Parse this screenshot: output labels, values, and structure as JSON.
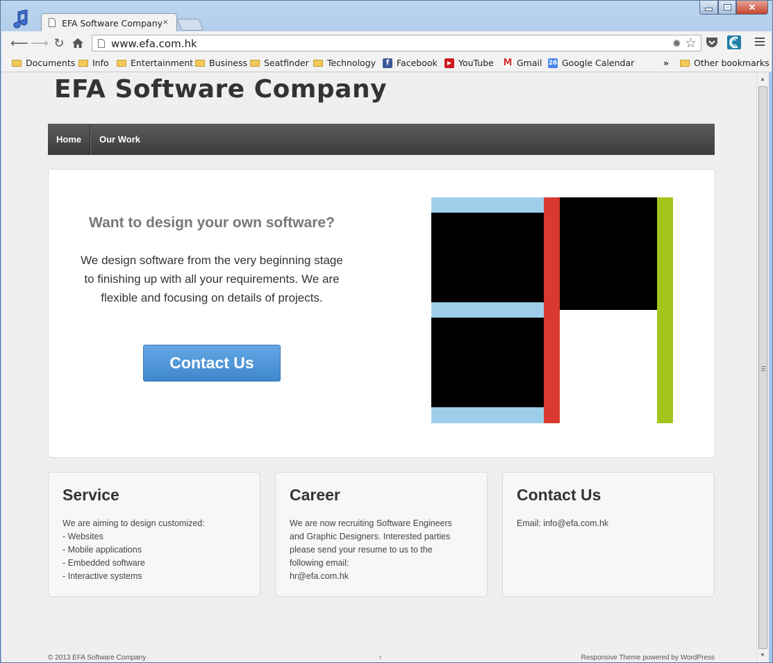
{
  "browser": {
    "tab_title": "EFA Software Company",
    "tab_close": "×",
    "url": "www.efa.com.hk",
    "bookmarks": [
      {
        "label": "Documents",
        "icon": "folder-icon"
      },
      {
        "label": "Info",
        "icon": "folder-icon"
      },
      {
        "label": "Entertainment",
        "icon": "folder-icon"
      },
      {
        "label": "Business",
        "icon": "folder-icon"
      },
      {
        "label": "Seatfinder",
        "icon": "folder-icon"
      },
      {
        "label": "Technology",
        "icon": "folder-icon"
      },
      {
        "label": "Facebook",
        "icon": "facebook-icon"
      },
      {
        "label": "YouTube",
        "icon": "youtube-icon"
      },
      {
        "label": "Gmail",
        "icon": "gmail-icon"
      },
      {
        "label": "Google Calendar",
        "icon": "calendar-icon",
        "badge": "26"
      }
    ],
    "bookmarks_overflow": "»",
    "other_bookmarks": "Other bookmarks"
  },
  "site": {
    "title": "EFA Software Company",
    "nav": [
      {
        "label": "Home"
      },
      {
        "label": "Our Work"
      }
    ],
    "hero": {
      "heading": "Want to design your own software?",
      "text": "We design software from the very beginning stage to finishing up with all your requirements. We are flexible and focusing on details of projects.",
      "button": "Contact Us"
    },
    "cards": [
      {
        "title": "Service",
        "lines": [
          "We are aiming to design customized:",
          "- Websites",
          "- Mobile applications",
          "- Embedded software",
          "- Interactive systems"
        ]
      },
      {
        "title": "Career",
        "lines": [
          "We are now recruiting Software Engineers",
          "and Graphic Designers. Interested parties",
          "please send your resume to us to the",
          "following email:",
          "hr@efa.com.hk"
        ]
      },
      {
        "title": "Contact Us",
        "lines": [
          "Email: info@efa.com.hk"
        ]
      }
    ],
    "footer": {
      "left": "© 2013 EFA Software Company",
      "mid": "↑",
      "right": "Responsive Theme powered by WordPress"
    }
  },
  "colors": {
    "graphic_light_blue": "#9ecfea",
    "graphic_black": "#000000",
    "graphic_red": "#d9392f",
    "graphic_green": "#a3c41d",
    "button_blue": "#4b94d8",
    "nav_dark": "#4a4a4a"
  }
}
